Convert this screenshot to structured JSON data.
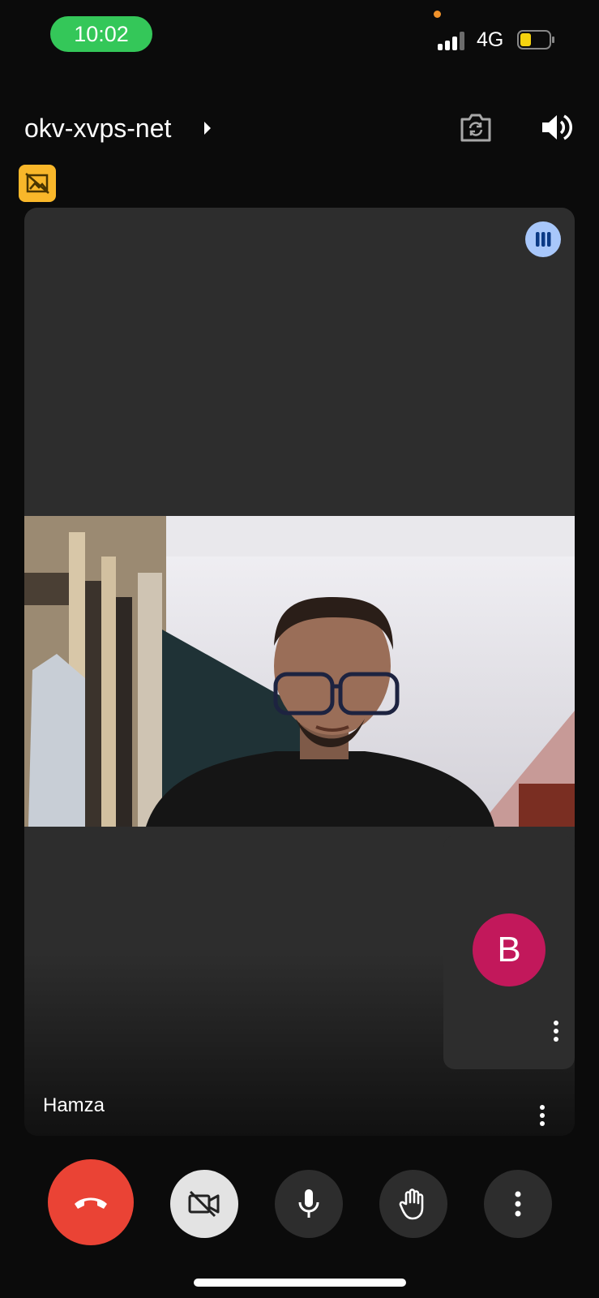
{
  "status_bar": {
    "time": "10:02",
    "network": "4G",
    "battery_level": 0.35,
    "battery_color": "#f5d30f"
  },
  "top_bar": {
    "meeting_code": "okv-xvps-net",
    "icons": [
      "camera-flip-icon",
      "speaker-icon",
      "no-video-notice-icon"
    ]
  },
  "main_tile": {
    "participant_name": "Hamza",
    "audio_indicator_icon": "audio-level-icon"
  },
  "self_tile": {
    "avatar_initial": "B",
    "avatar_color": "#c2185b"
  },
  "controls": {
    "items": [
      "end-call",
      "camera-off",
      "microphone",
      "raise-hand",
      "more-options"
    ],
    "end_call_color": "#ea4335"
  }
}
